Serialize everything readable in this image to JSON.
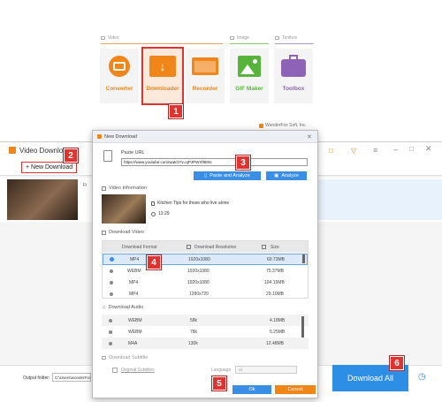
{
  "launcher": {
    "sections": [
      "Video",
      "Image",
      "Toolbox"
    ],
    "tiles": [
      {
        "label": "Converter",
        "color": "#f08519"
      },
      {
        "label": "Downloader",
        "color": "#f08519"
      },
      {
        "label": "Recorder",
        "color": "#f08519"
      },
      {
        "label": "GIF Maker",
        "color": "#57b43a"
      },
      {
        "label": "Toolbox",
        "color": "#8d62b7"
      }
    ],
    "copyright": "WonderFox Soft, Inc."
  },
  "badges": [
    "1",
    "2",
    "3",
    "4",
    "5",
    "6"
  ],
  "bg_window": {
    "title": "Video Download",
    "new_download": "+ New Download",
    "output_label": "Output folder:",
    "output_value": "C:\\Users\\wonderFox",
    "download_all": "Download All"
  },
  "dialog": {
    "title": "New Download",
    "paste_url_label": "Paste URL",
    "url_value": "https://www.youtube.com/watch?v=qPJPWXf9E8c",
    "paste_analyze": "Paste and Analyze",
    "analyze": "Analyze",
    "video_info_label": "Video Information",
    "video_title": "Kitchen Tips for those who live alone",
    "duration": "13:29",
    "download_video_label": "Download Video",
    "col_format": "Download Format",
    "col_resolution": "Download Resolution",
    "col_size": "Size",
    "video_rows": [
      {
        "format": "MP4",
        "res": "1920x1080",
        "size": "60.73MB"
      },
      {
        "format": "WEBM",
        "res": "1920x1080",
        "size": "75.37MB"
      },
      {
        "format": "MP4",
        "res": "1920x1080",
        "size": "104.15MB"
      },
      {
        "format": "MP4",
        "res": "1280x720",
        "size": "29.10MB"
      }
    ],
    "download_audio_label": "Download Audio",
    "audio_rows": [
      {
        "format": "WEBM",
        "bitrate": "58k",
        "size": "4.18MB"
      },
      {
        "format": "WEBM",
        "bitrate": "78k",
        "size": "5.25MB"
      },
      {
        "format": "M4A",
        "bitrate": "130k",
        "size": "12.48MB"
      }
    ],
    "download_subtitle_label": "Download Subtitle",
    "original_subtitles": "Original Subtitles",
    "language_label": "Language",
    "language_value": "all",
    "ok": "Ok",
    "cancel": "Cancel"
  }
}
